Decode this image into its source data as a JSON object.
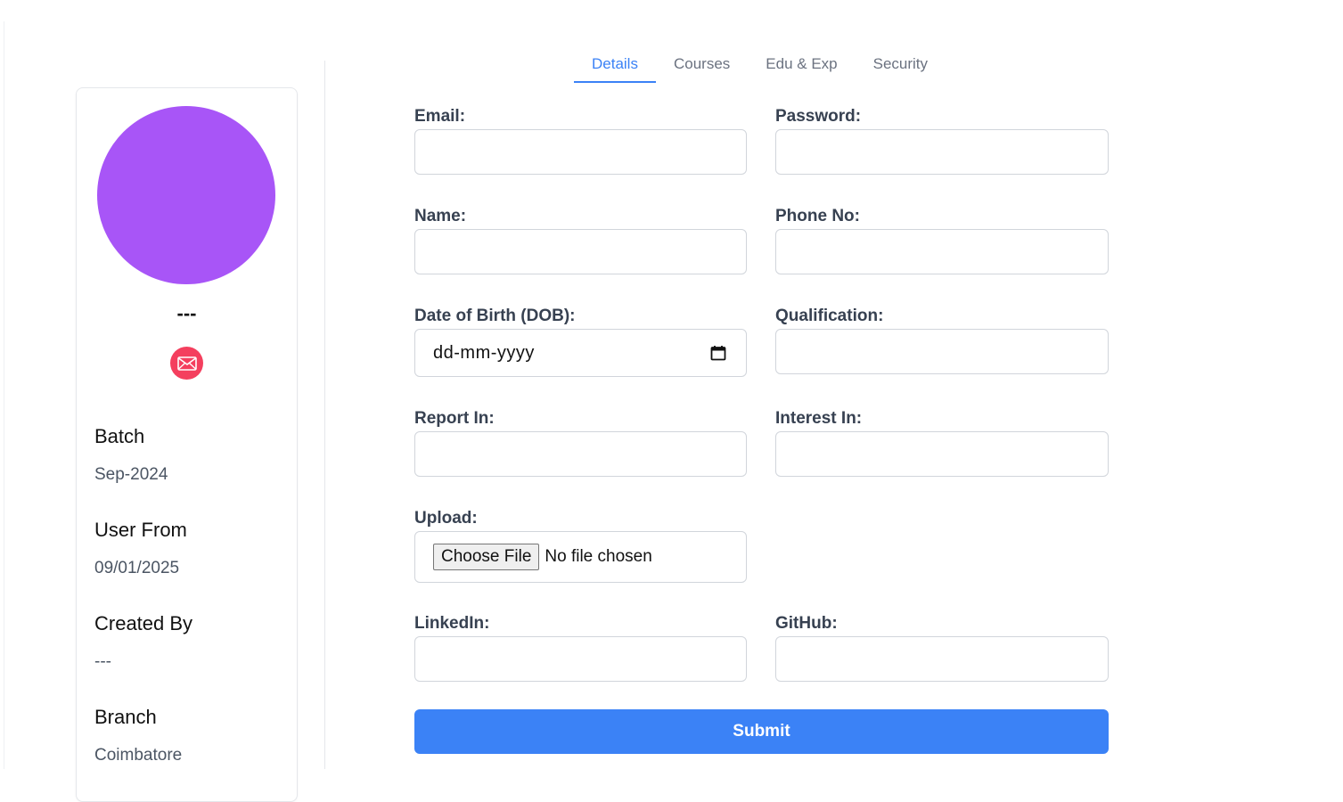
{
  "colors": {
    "accent": "#3b82f6",
    "avatar": "#a855f7",
    "mail_button": "#f43f5e"
  },
  "profile": {
    "name": "---",
    "mail_icon": "envelope-icon",
    "info": [
      {
        "label": "Batch",
        "value": "Sep-2024"
      },
      {
        "label": "User From",
        "value": "09/01/2025"
      },
      {
        "label": "Created By",
        "value": "---"
      },
      {
        "label": "Branch",
        "value": "Coimbatore"
      }
    ]
  },
  "tabs": [
    {
      "label": "Details",
      "active": true
    },
    {
      "label": "Courses",
      "active": false
    },
    {
      "label": "Edu & Exp",
      "active": false
    },
    {
      "label": "Security",
      "active": false
    }
  ],
  "form": {
    "email": {
      "label": "Email:",
      "value": ""
    },
    "password": {
      "label": "Password:",
      "value": ""
    },
    "name": {
      "label": "Name:",
      "value": ""
    },
    "phone": {
      "label": "Phone No:",
      "value": ""
    },
    "dob": {
      "label": "Date of Birth (DOB):",
      "placeholder": "dd-mm-yyyy",
      "icon": "calendar-icon"
    },
    "qualification": {
      "label": "Qualification:",
      "value": ""
    },
    "report_in": {
      "label": "Report In:",
      "value": ""
    },
    "interest_in": {
      "label": "Interest In:",
      "value": ""
    },
    "upload": {
      "label": "Upload:",
      "button": "Choose File",
      "status": "No file chosen"
    },
    "linkedin": {
      "label": "LinkedIn:",
      "value": ""
    },
    "github": {
      "label": "GitHub:",
      "value": ""
    },
    "submit_label": "Submit"
  }
}
